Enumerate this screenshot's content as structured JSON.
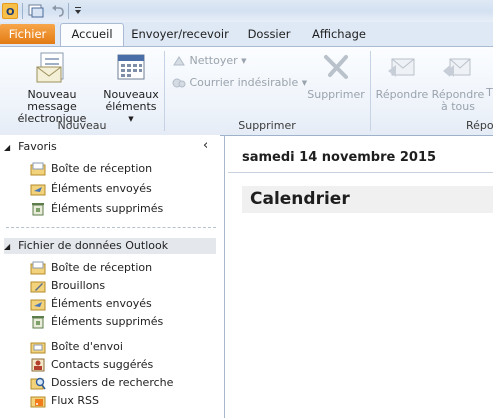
{
  "tabs": {
    "fichier": "Fichier",
    "accueil": "Accueil",
    "envoyer": "Envoyer/recevoir",
    "dossier": "Dossier",
    "affichage": "Affichage"
  },
  "ribbon": {
    "new_message": [
      "Nouveau message",
      "électronique"
    ],
    "new_items": [
      "Nouveaux",
      "éléments"
    ],
    "group_new": "Nouveau",
    "nettoyer": "Nettoyer",
    "courrier_indesirable": "Courrier indésirable",
    "supprimer_btn": "Supprimer",
    "group_delete": "Supprimer",
    "repondre": "Répondre",
    "repondre_tous": [
      "Répondre",
      "à tous"
    ],
    "transferer_partial": "T",
    "group_respond_partial": "Répo"
  },
  "nav": {
    "favoris": "Favoris",
    "collapse_glyph": "‹",
    "favorites": [
      "Boîte de réception",
      "Éléments envoyés",
      "Éléments supprimés"
    ],
    "data_file": "Fichier de données Outlook",
    "folders": [
      "Boîte de réception",
      "Brouillons",
      "Éléments envoyés",
      "Éléments supprimés"
    ],
    "other_folders": [
      "Boîte d'envoi",
      "Contacts suggérés",
      "Dossiers de recherche",
      "Flux RSS"
    ]
  },
  "calendar": {
    "date": "samedi 14 novembre 2015",
    "title": "Calendrier"
  },
  "colors": {
    "file_tab": "#e37b14",
    "ribbon_bg": "#eef3fa",
    "selected_row": "#e4e8ed"
  }
}
